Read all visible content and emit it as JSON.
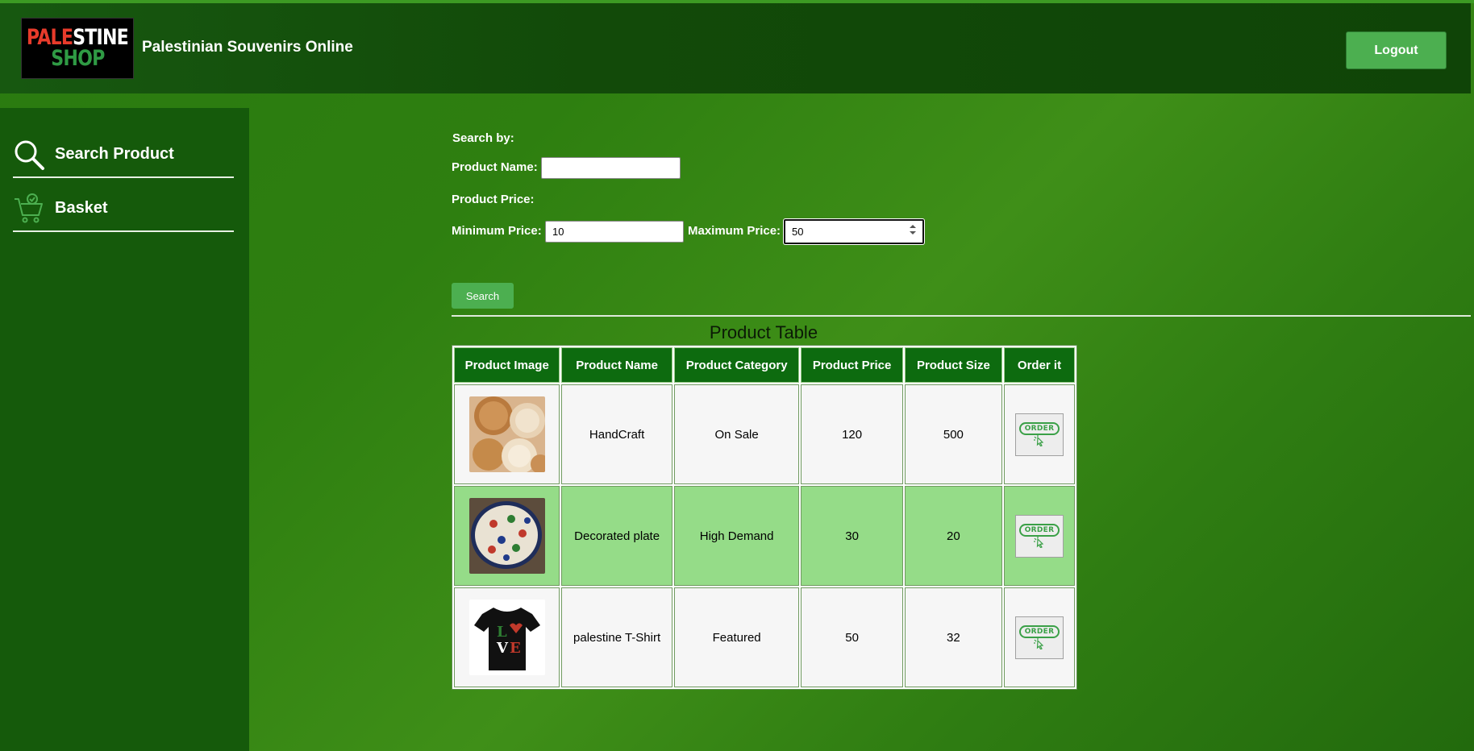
{
  "header": {
    "logo_line1_red": "PALE",
    "logo_line1_white": "STINE",
    "logo_line2": "SHOP",
    "title": "Palestinian Souvenirs Online",
    "logout_label": "Logout"
  },
  "sidebar": {
    "items": [
      {
        "label": "Search Product",
        "icon": "search-icon"
      },
      {
        "label": "Basket",
        "icon": "cart-icon"
      }
    ]
  },
  "search": {
    "heading": "Search by:",
    "name_label": "Product Name:",
    "name_value": "",
    "price_label": "Product Price:",
    "min_label": "Minimum Price:",
    "min_value": "10",
    "max_label": "Maximum Price:",
    "max_value": "50",
    "button_label": "Search"
  },
  "table": {
    "title": "Product Table",
    "headers": [
      "Product Image",
      "Product Name",
      "Product Category",
      "Product Price",
      "Product Size",
      "Order it"
    ],
    "order_label": "ORDER",
    "rows": [
      {
        "name": "HandCraft",
        "category": "On Sale",
        "price": "120",
        "size": "500",
        "image": "handcraft-bowls-image"
      },
      {
        "name": "Decorated plate",
        "category": "High Demand",
        "price": "30",
        "size": "20",
        "image": "decorated-plate-image"
      },
      {
        "name": "palestine T-Shirt",
        "category": "Featured",
        "price": "50",
        "size": "32",
        "image": "love-tshirt-image"
      }
    ]
  },
  "colors": {
    "header_bg": "#124a09",
    "sidebar_bg": "#155a0b",
    "button_green": "#4caf50",
    "table_header": "#0d6b0f",
    "row_alt": "#95dc88"
  }
}
